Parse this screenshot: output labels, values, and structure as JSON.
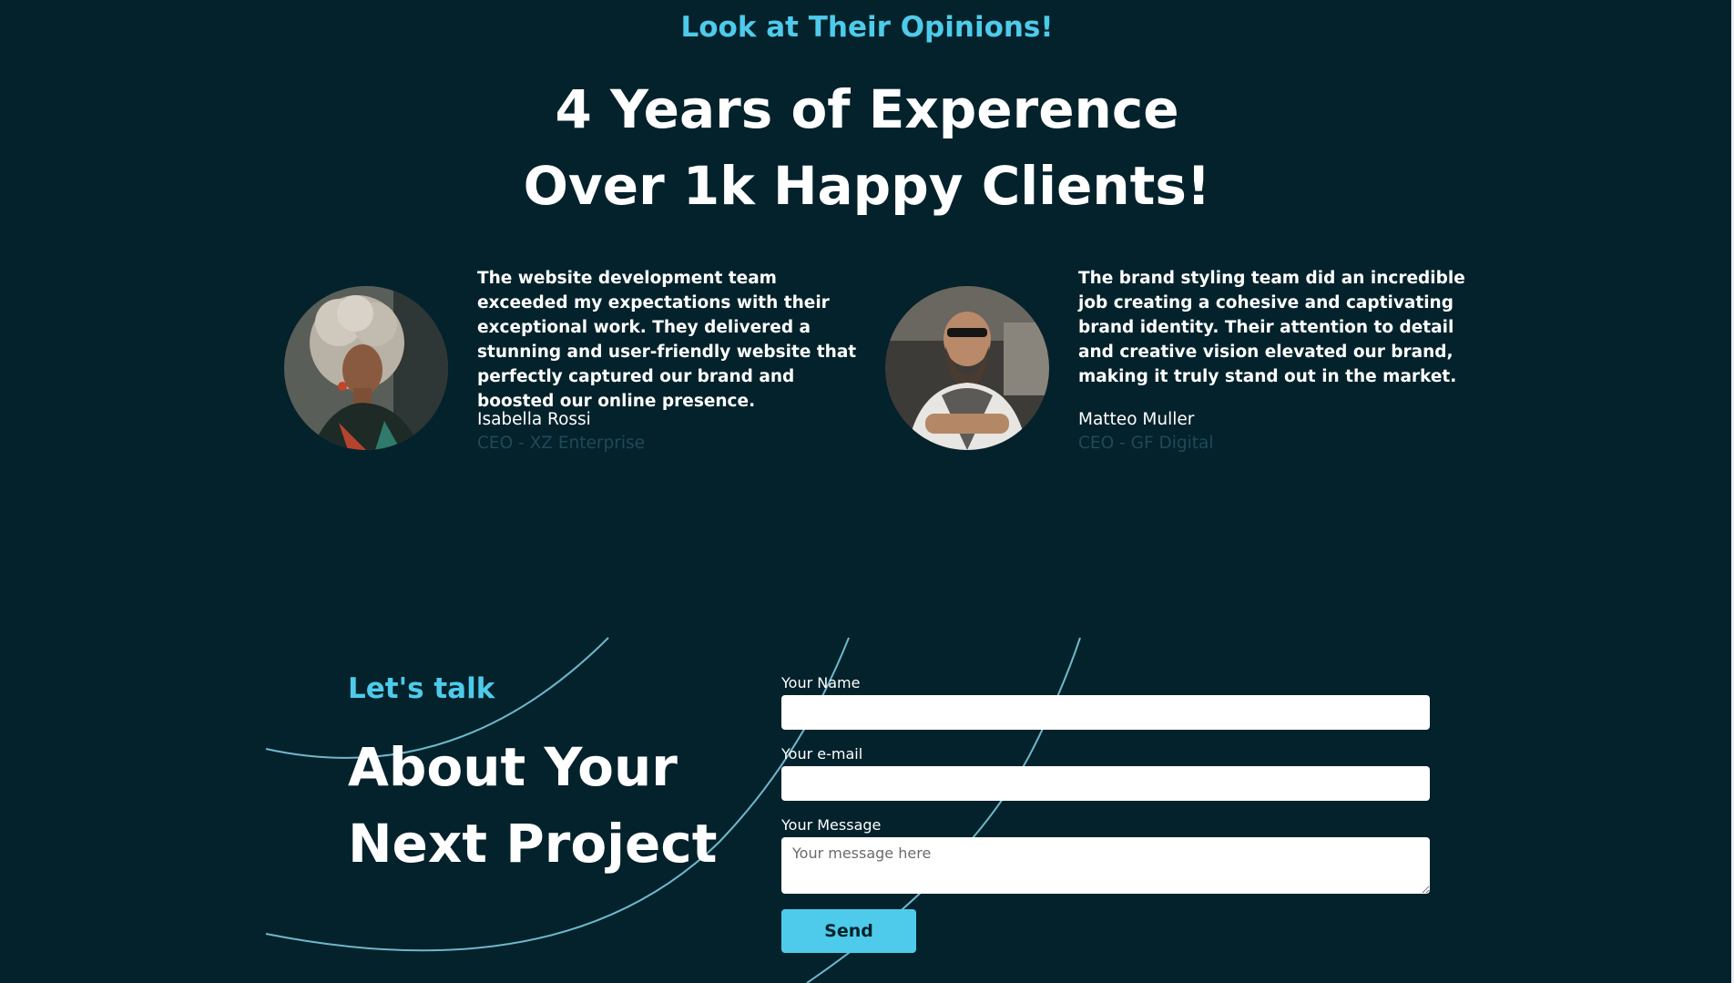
{
  "testimonials_section": {
    "eyebrow": "Look at Their Opinions!",
    "headline_line1": "4 Years of Experence",
    "headline_line2": "Over 1k Happy Clients!"
  },
  "testimonials": [
    {
      "quote": "The website development team exceeded my expectations with their exceptional work. They delivered a stunning and user-friendly website that perfectly captured our brand and boosted our online presence.",
      "name": "Isabella Rossi",
      "role": "CEO - XZ Enterprise"
    },
    {
      "quote": "The brand styling team did an incredible job creating a cohesive and captivating brand identity. Their attention to detail and creative vision elevated our brand, making it truly stand out in the market.",
      "name": "Matteo Muller",
      "role": "CEO - GF Digital"
    }
  ],
  "contact": {
    "eyebrow": "Let's talk",
    "title_line1": "About Your",
    "title_line2": "Next Project",
    "name_label": "Your Name",
    "email_label": "Your e-mail",
    "message_label": "Your Message",
    "message_placeholder": "Your message here",
    "send_label": "Send"
  },
  "colors": {
    "background": "#04222b",
    "accent": "#4ecbeb",
    "role_text": "#1e4a5a"
  }
}
